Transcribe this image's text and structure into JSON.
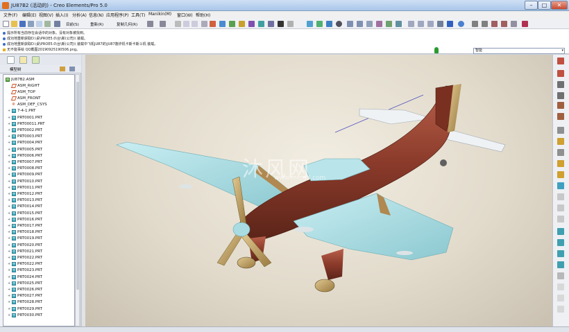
{
  "window": {
    "title": "JU87B2 (活动的) - Creo Elements/Pro 5.0"
  },
  "menu": [
    "文件(F)",
    "编辑(E)",
    "视图(V)",
    "插入(I)",
    "分析(A)",
    "信息(N)",
    "应用程序(P)",
    "工具(T)",
    "Manikin(M)",
    "窗口(W)",
    "帮助(H)"
  ],
  "toolbar": {
    "regen_label": "目前(S)",
    "zoom_label": "重新(R)",
    "copy_label": "复制几何(R)"
  },
  "messages": [
    "提示所有当前存在会话中的对象。没有对象被找到。",
    "成功地重新获取D:\\桌\\PROE5.0\\台\\新(公司)\\ 装载。",
    "成功地重新获取D:\\桌\\PROE5.0\\台\\新(公司)\\ 装载中飞机JU87的\\JU87轰炸机卡斯卡斯斗机 装载。",
    "无不能事绘 QQ截图20190925190506.png。"
  ],
  "filter": {
    "value": "智能"
  },
  "model_tree": {
    "header": "模型树",
    "root": "JU87B2.ASM",
    "items": [
      {
        "label": "ASM_RIGHT",
        "kind": "plane"
      },
      {
        "label": "ASM_TOP",
        "kind": "plane"
      },
      {
        "label": "ASM_FRONT",
        "kind": "plane"
      },
      {
        "label": "ASM_DEF_CSYS",
        "kind": "csys"
      },
      {
        "label": "7-4-1.PRT",
        "kind": "part"
      },
      {
        "label": "PRT0001.PRT",
        "kind": "part"
      },
      {
        "label": "PRT00011.PRT",
        "kind": "part"
      },
      {
        "label": "PRT0002.PRT",
        "kind": "part"
      },
      {
        "label": "PRT0003.PRT",
        "kind": "part"
      },
      {
        "label": "PRT0004.PRT",
        "kind": "part"
      },
      {
        "label": "PRT0005.PRT",
        "kind": "part"
      },
      {
        "label": "PRT0006.PRT",
        "kind": "part"
      },
      {
        "label": "PRT0007.PRT",
        "kind": "part"
      },
      {
        "label": "PRT0008.PRT",
        "kind": "part"
      },
      {
        "label": "PRT0009.PRT",
        "kind": "part"
      },
      {
        "label": "PRT0010.PRT",
        "kind": "part"
      },
      {
        "label": "PRT0011.PRT",
        "kind": "part"
      },
      {
        "label": "PRT0012.PRT",
        "kind": "part"
      },
      {
        "label": "PRT0013.PRT",
        "kind": "part"
      },
      {
        "label": "PRT0014.PRT",
        "kind": "part"
      },
      {
        "label": "PRT0015.PRT",
        "kind": "part"
      },
      {
        "label": "PRT0016.PRT",
        "kind": "part"
      },
      {
        "label": "PRT0017.PRT",
        "kind": "part"
      },
      {
        "label": "PRT0018.PRT",
        "kind": "part"
      },
      {
        "label": "PRT0019.PRT",
        "kind": "part"
      },
      {
        "label": "PRT0020.PRT",
        "kind": "part"
      },
      {
        "label": "PRT0021.PRT",
        "kind": "part"
      },
      {
        "label": "PRT0022.PRT",
        "kind": "part"
      },
      {
        "label": "PRT0022.PRT",
        "kind": "part"
      },
      {
        "label": "PRT0023.PRT",
        "kind": "part"
      },
      {
        "label": "PRT0024.PRT",
        "kind": "part"
      },
      {
        "label": "PRT0025.PRT",
        "kind": "part"
      },
      {
        "label": "PRT0026.PRT",
        "kind": "part"
      },
      {
        "label": "PRT0027.PRT",
        "kind": "part"
      },
      {
        "label": "PRT0028.PRT",
        "kind": "part"
      },
      {
        "label": "PRT0029.PRT",
        "kind": "part"
      },
      {
        "label": "PRT0030.PRT",
        "kind": "part"
      }
    ]
  },
  "watermark": {
    "text": "沐风网",
    "url": "www.mfcad.com"
  },
  "colors": {
    "fuselage": "#8a3a2a",
    "wing": "#a8dce2",
    "tail_white": "#eef2f4",
    "background": "#e2dbcc"
  }
}
